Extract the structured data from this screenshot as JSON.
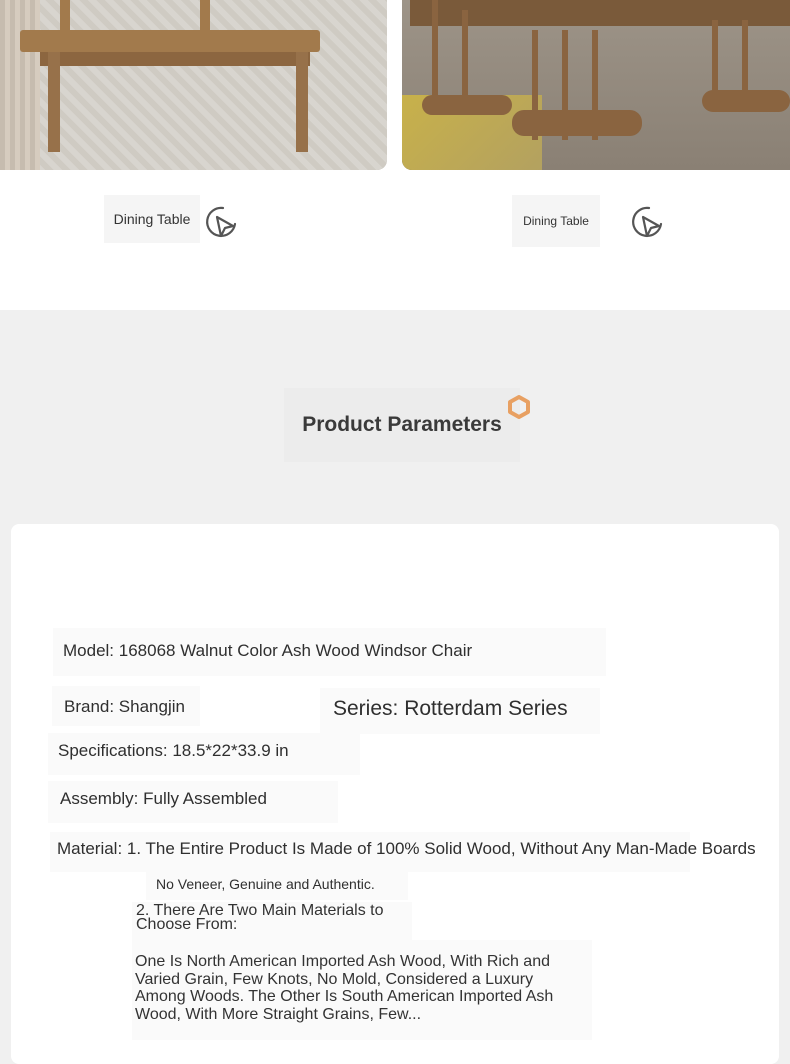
{
  "gallery": {
    "captions": [
      "Dining Table",
      "Dining Table"
    ],
    "icon": "cursor-click-icon"
  },
  "section": {
    "title": "Product Parameters",
    "title_icon": "hexagon-icon",
    "accent_color": "#e8a062"
  },
  "params": {
    "model": "Model: 168068 Walnut Color Ash Wood Windsor Chair",
    "brand": "Brand: Shangjin",
    "series": "Series: Rotterdam Series",
    "specifications": "Specifications: 18.5*22*33.9 in",
    "assembly": "Assembly: Fully Assembled",
    "material": "Material: 1. The Entire Product Is Made of 100% Solid Wood, Without Any Man-Made Boards",
    "material_note": "No Veneer, Genuine and Authentic.",
    "materials_choice": "2. There Are Two Main Materials to Choose From:",
    "materials_desc": "One Is North American Imported Ash Wood, With Rich and Varied Grain, Few Knots, No Mold, Considered a Luxury Among Woods. The Other Is South American Imported Ash Wood, With More Straight Grains, Few..."
  }
}
